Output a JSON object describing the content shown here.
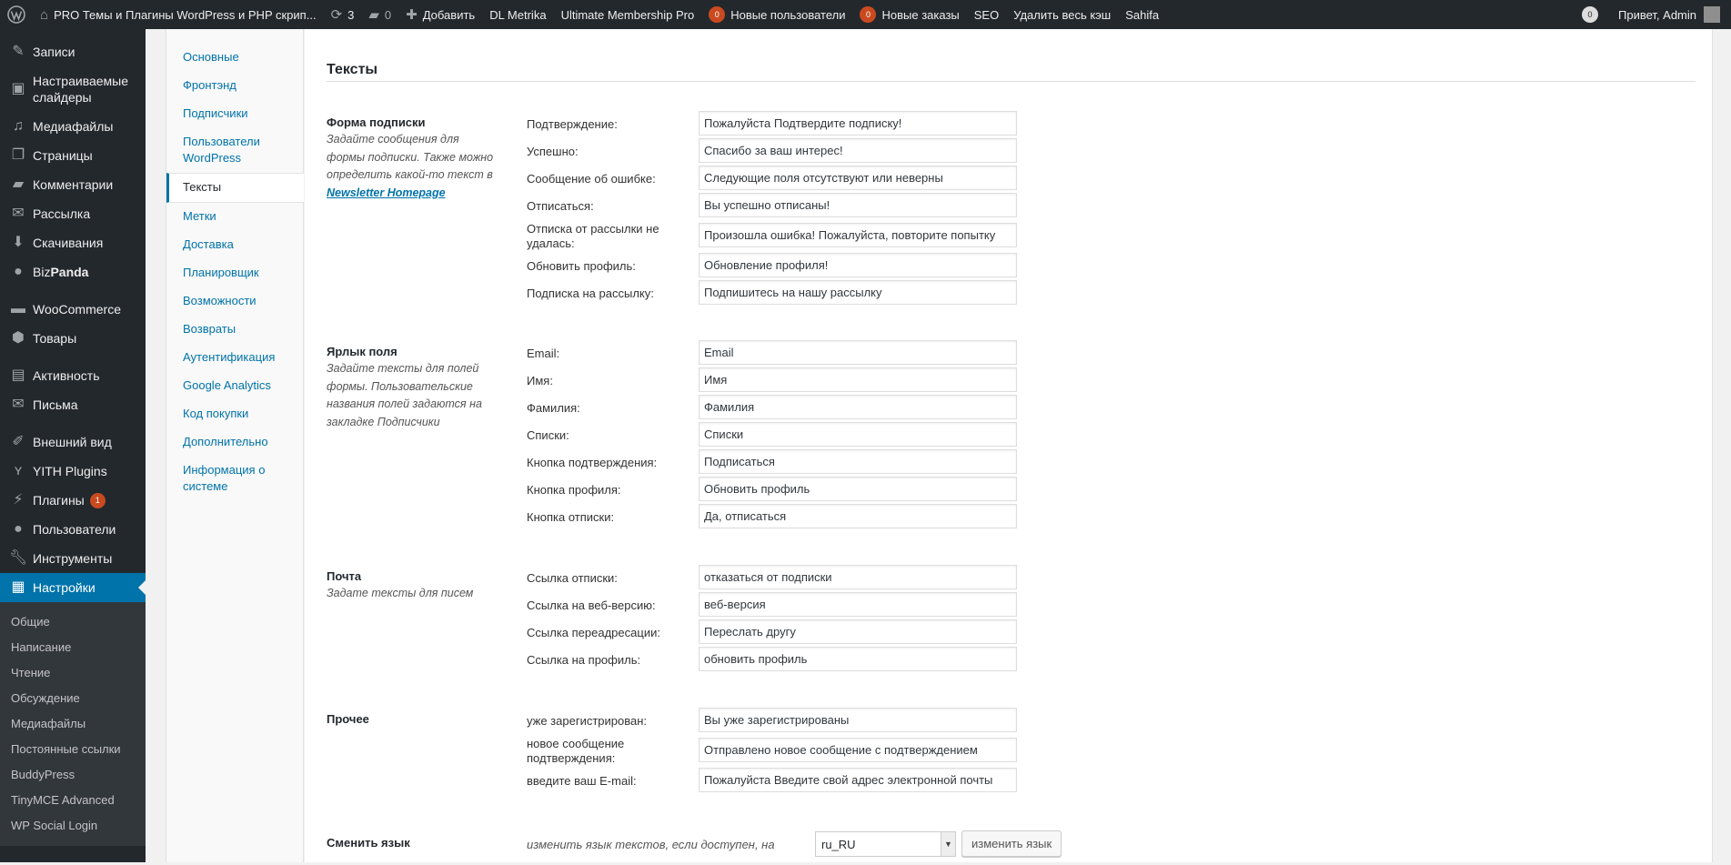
{
  "admin_bar": {
    "site_name": "PRO Темы и Плагины WordPress и PHP скрип...",
    "updates_count": "3",
    "comments_count": "0",
    "add_new": "Добавить",
    "items": [
      "DL Metrika",
      "Ultimate Membership Pro"
    ],
    "new_users_count": "0",
    "new_users": "Новые пользователи",
    "new_orders_count": "0",
    "new_orders": "Новые заказы",
    "seo": "SEO",
    "clear_cache": "Удалить весь кэш",
    "theme": "Sahifa",
    "right_count": "0",
    "greeting": "Привет, Admin"
  },
  "admin_menu": {
    "items": [
      {
        "label": "Записи",
        "icon": "pin-icon"
      },
      {
        "label": "Настраиваемые слайдеры",
        "icon": "slider-icon"
      },
      {
        "label": "Медиафайлы",
        "icon": "media-icon"
      },
      {
        "label": "Страницы",
        "icon": "page-icon"
      },
      {
        "label": "Комментарии",
        "icon": "comment-icon"
      },
      {
        "label": "Рассылка",
        "icon": "mail-icon"
      },
      {
        "label": "Скачивания",
        "icon": "download-icon"
      },
      {
        "label_prefix": "Biz",
        "label_bold": "Panda",
        "icon": "panda-icon"
      },
      {
        "label": "WooCommerce",
        "icon": "woo-icon"
      },
      {
        "label": "Товары",
        "icon": "box-icon"
      },
      {
        "label": "Активность",
        "icon": "activity-icon"
      },
      {
        "label": "Письма",
        "icon": "envelope-icon"
      },
      {
        "label": "Внешний вид",
        "icon": "brush-icon"
      },
      {
        "label": "YITH Plugins",
        "icon": "yith-icon"
      },
      {
        "label": "Плагины",
        "icon": "plugin-icon",
        "badge": "1"
      },
      {
        "label": "Пользователи",
        "icon": "user-icon"
      },
      {
        "label": "Инструменты",
        "icon": "wrench-icon"
      },
      {
        "label": "Настройки",
        "icon": "settings-icon"
      }
    ],
    "submenu": [
      "Общие",
      "Написание",
      "Чтение",
      "Обсуждение",
      "Медиафайлы",
      "Постоянные ссылки",
      "BuddyPress",
      "TinyMCE Advanced",
      "WP Social Login"
    ]
  },
  "sub_nav": [
    "Основные",
    "Фронтэнд",
    "Подписчики",
    "Пользователи WordPress",
    "Тексты",
    "Метки",
    "Доставка",
    "Планировщик",
    "Возможности",
    "Возвраты",
    "Аутентификация",
    "Google Analytics",
    "Код покупки",
    "Дополнительно",
    "Информация о системе"
  ],
  "page_title": "Тексты",
  "sections": {
    "subscribe_form": {
      "title": "Форма подписки",
      "desc1": "Задайте сообщения для формы подписки.",
      "desc2": "Также можно определить какой-то текст в",
      "link": "Newsletter Homepage",
      "rows": [
        {
          "label": "Подтверждение:",
          "value": "Пожалуйста Подтвердите подписку!"
        },
        {
          "label": "Успешно:",
          "value": "Спасибо за ваш интерес!"
        },
        {
          "label": "Сообщение об ошибке:",
          "value": "Следующие поля отсутствуют или неверны"
        },
        {
          "label": "Отписаться:",
          "value": "Вы успешно отписаны!"
        },
        {
          "label": "Отписка от рассылки не удалась:",
          "value": "Произошла ошибка! Пожалуйста, повторите попытку"
        },
        {
          "label": "Обновить профиль:",
          "value": "Обновление профиля!"
        },
        {
          "label": "Подписка на рассылку:",
          "value": "Подпишитесь на нашу рассылку"
        }
      ]
    },
    "field_labels": {
      "title": "Ярлык поля",
      "desc": "Задайте тексты для полей формы. Пользовательские названия полей задаются на закладке Подписчики",
      "rows": [
        {
          "label": "Email:",
          "value": "Email"
        },
        {
          "label": "Имя:",
          "value": "Имя"
        },
        {
          "label": "Фамилия:",
          "value": "Фамилия"
        },
        {
          "label": "Списки:",
          "value": "Списки"
        },
        {
          "label": "Кнопка подтверждения:",
          "value": "Подписаться"
        },
        {
          "label": "Кнопка профиля:",
          "value": "Обновить профиль"
        },
        {
          "label": "Кнопка отписки:",
          "value": "Да, отписаться"
        }
      ]
    },
    "mail": {
      "title": "Почта",
      "desc": "Задате тексты для писем",
      "rows": [
        {
          "label": "Ссылка отписки:",
          "value": "отказаться от подписки"
        },
        {
          "label": "Ссылка на веб-версию:",
          "value": "веб-версия"
        },
        {
          "label": "Ссылка переадресации:",
          "value": "Переслать другу"
        },
        {
          "label": "Ссылка на профиль:",
          "value": "обновить профиль"
        }
      ]
    },
    "other": {
      "title": "Прочее",
      "rows": [
        {
          "label": "уже зарегистрирован:",
          "value": "Вы уже зарегистрированы"
        },
        {
          "label": "новое сообщение подтверждения:",
          "value": "Отправлено новое сообщение с подтверждением"
        },
        {
          "label": "введите ваш E-mail:",
          "value": "Пожалуйста Введите свой адрес электронной почты"
        }
      ]
    }
  },
  "language": {
    "title": "Сменить язык",
    "hint": "изменить язык текстов, если доступен, на",
    "selected": "ru_RU",
    "button": "изменить язык"
  },
  "colors": {
    "admin_bg": "#23282d",
    "accent": "#0073aa",
    "badge": "#ca4a1f"
  }
}
